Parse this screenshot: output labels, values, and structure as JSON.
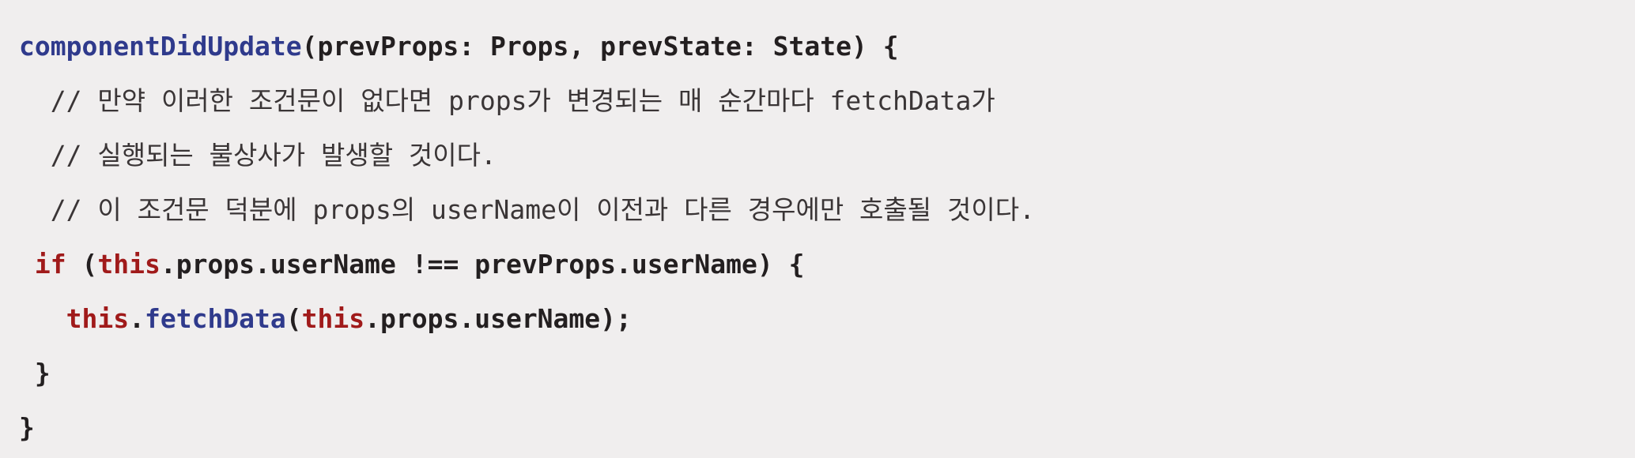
{
  "code": {
    "signature_fn": "componentDidUpdate",
    "signature_rest": "(prevProps: Props, prevState: State) {",
    "comments": [
      "// 만약 이러한 조건문이 없다면 props가 변경되는 매 순간마다 fetchData가",
      "// 실행되는 불상사가 발생할 것이다.",
      "// 이 조건문 덕분에 props의 userName이 이전과 다른 경우에만 호출될 것이다."
    ],
    "if_kw": "if",
    "if_open": " (",
    "if_this": "this",
    "if_rest": ".props.userName !== prevProps.userName) {",
    "call_this": "this",
    "call_dot": ".",
    "call_fn": "fetchData",
    "call_open": "(",
    "call_this2": "this",
    "call_rest": ".props.userName);",
    "inner_close": "}",
    "outer_close": "}"
  },
  "colors": {
    "function": "#2f3a8c",
    "keyword": "#a01a1a",
    "text": "#231f20",
    "background": "#f0eeee"
  }
}
